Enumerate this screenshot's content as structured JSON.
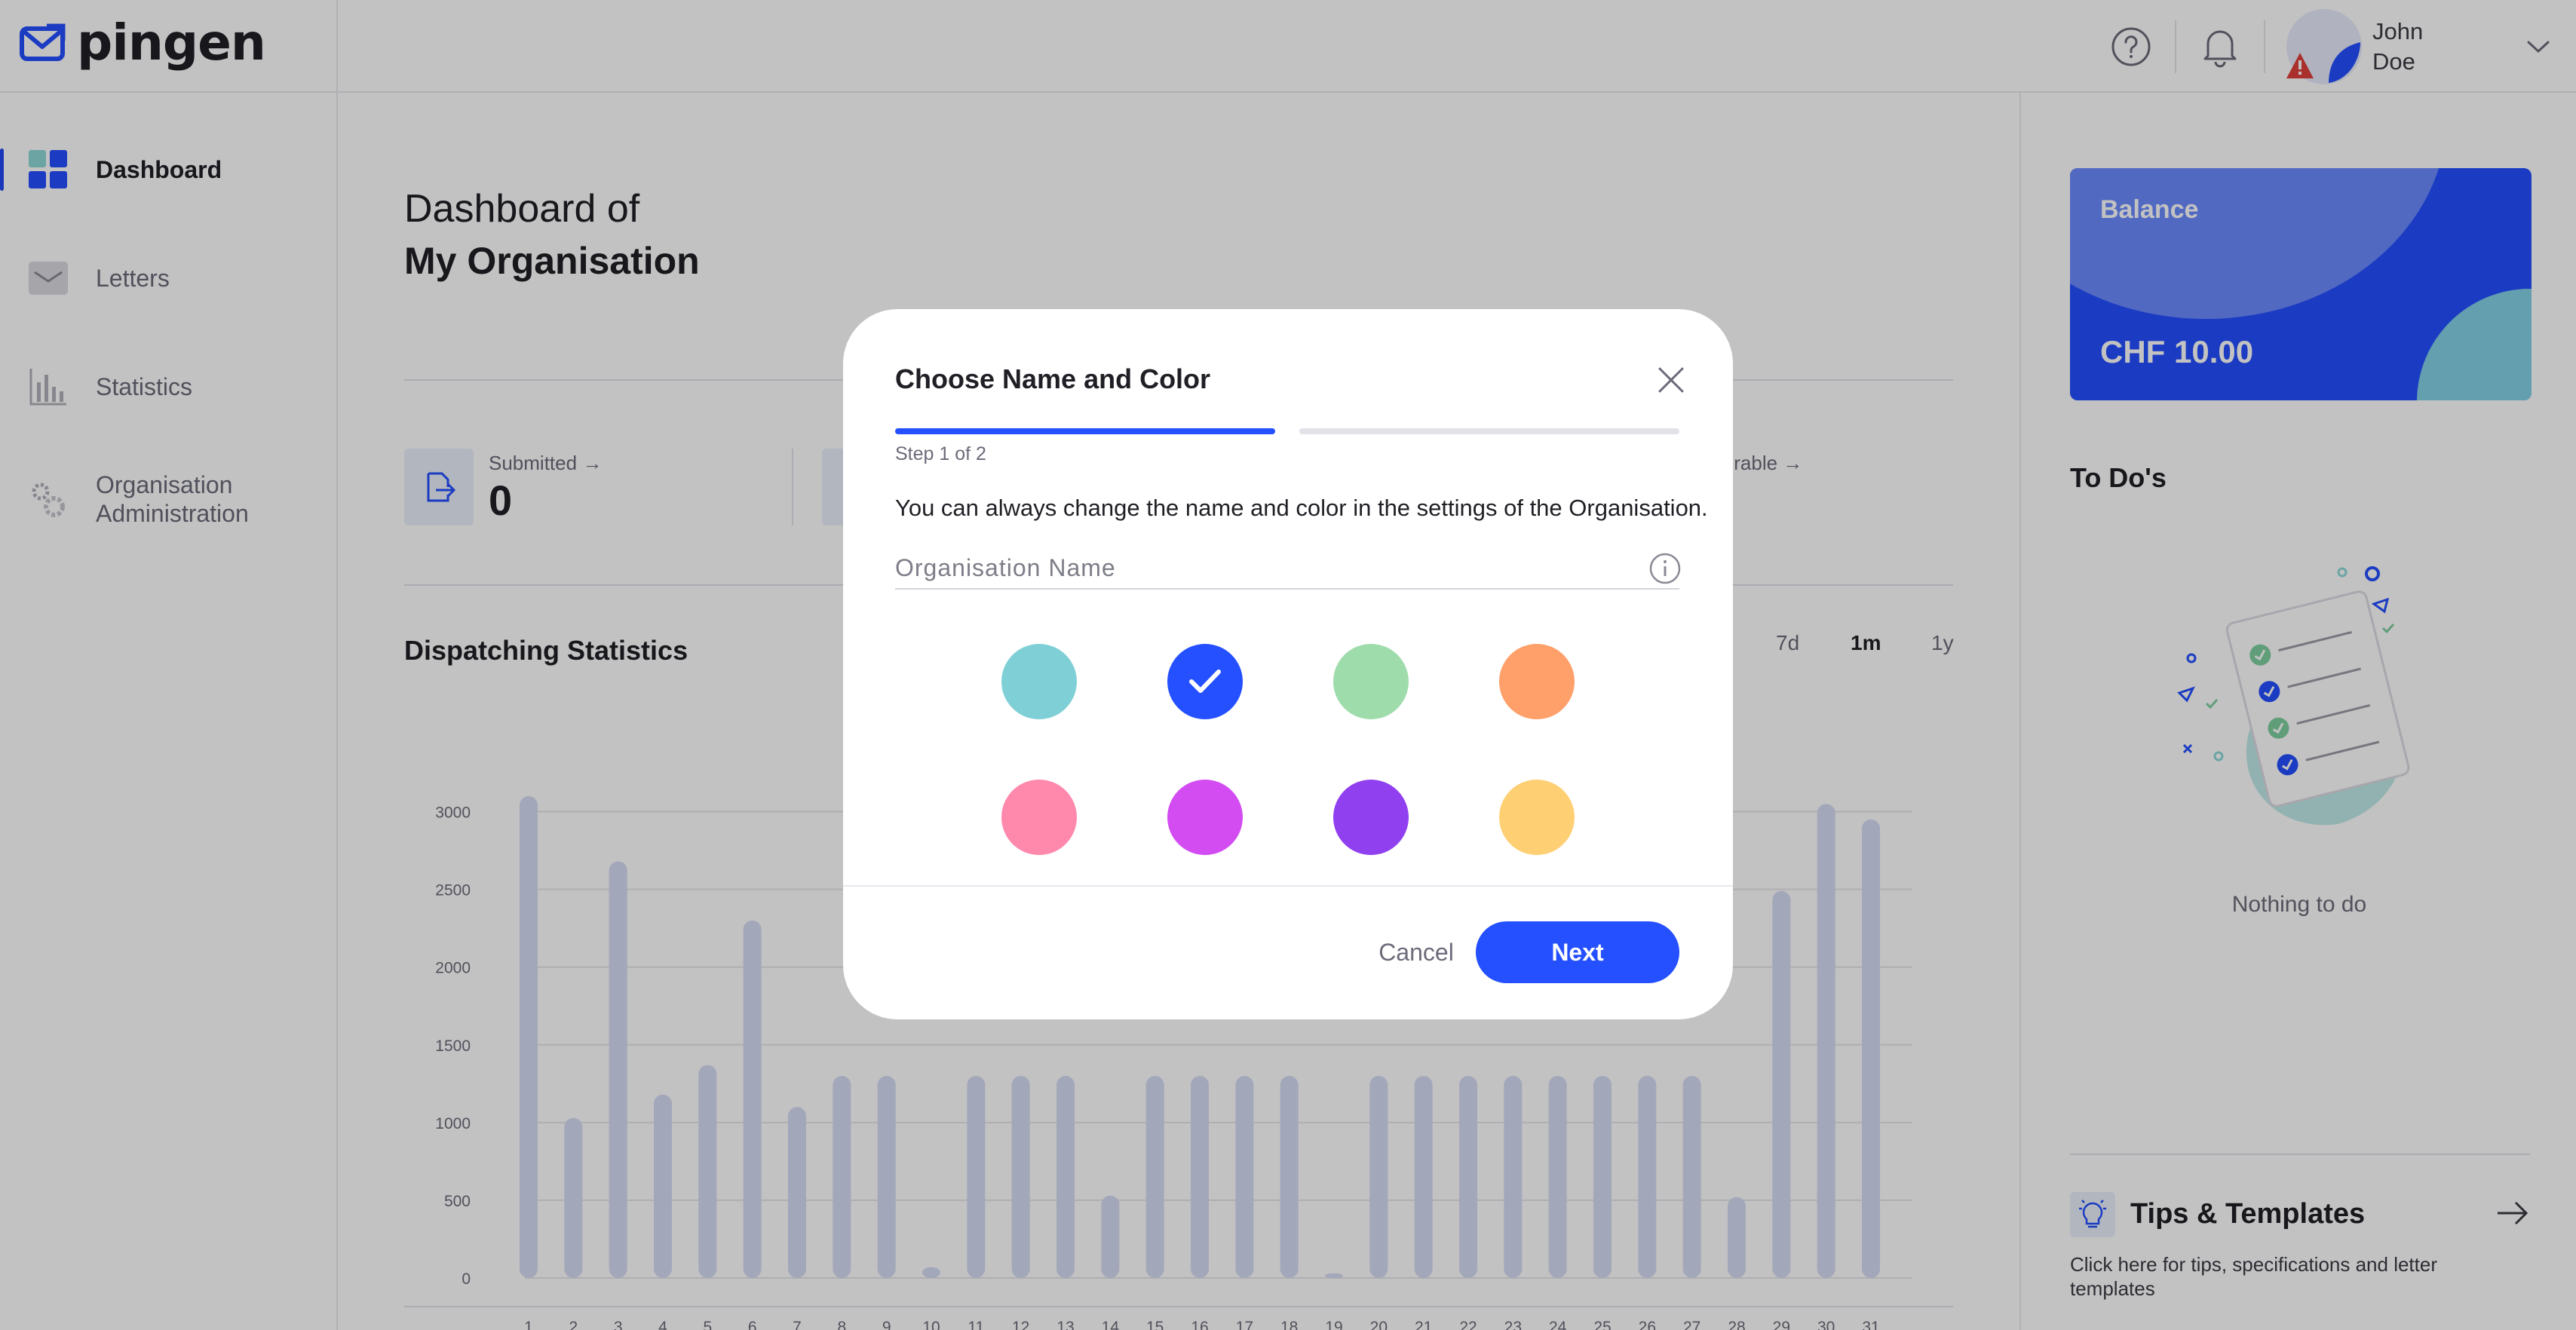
{
  "app": {
    "logo_text": "pingen"
  },
  "header": {
    "help_icon": "help-circle-icon",
    "bell_icon": "bell-icon",
    "user_first": "John",
    "user_last": "Doe"
  },
  "sidebar": {
    "items": [
      {
        "label": "Dashboard",
        "icon": "dashboard-grid-icon",
        "active": true
      },
      {
        "label": "Letters",
        "icon": "envelope-icon",
        "active": false
      },
      {
        "label": "Statistics",
        "icon": "bar-chart-icon",
        "active": false
      },
      {
        "label": "Organisation Administration",
        "icon": "gear-icon",
        "active": false
      }
    ]
  },
  "main": {
    "title_line1": "Dashboard of",
    "title_line2": "My Organisation",
    "stats": [
      {
        "label": "Submitted",
        "value": "0"
      },
      {
        "label": "iverable",
        "value": ""
      }
    ],
    "section_title": "Dispatching Statistics",
    "ranges": [
      "7d",
      "1m",
      "1y"
    ],
    "selected_range": "1m"
  },
  "chart_data": {
    "type": "bar",
    "categories": [
      "1",
      "2",
      "3",
      "4",
      "5",
      "6",
      "7",
      "8",
      "9",
      "10",
      "11",
      "12",
      "13",
      "14",
      "15",
      "16",
      "17",
      "18",
      "19",
      "20",
      "21",
      "22",
      "23",
      "24",
      "25",
      "26",
      "27",
      "28",
      "29",
      "30",
      "31"
    ],
    "values": [
      3100,
      1030,
      2680,
      1180,
      1370,
      2300,
      1100,
      1300,
      1300,
      70,
      1300,
      1300,
      1300,
      530,
      1300,
      1300,
      1300,
      1300,
      30,
      1300,
      1300,
      1300,
      1300,
      1300,
      1300,
      1300,
      1300,
      520,
      2490,
      3050,
      2950
    ],
    "yticks": [
      0,
      500,
      1000,
      1500,
      2000,
      2500,
      3000
    ],
    "ylim": [
      0,
      3250
    ],
    "bar_color": "#d6dcf5",
    "grid": true
  },
  "right": {
    "balance_label": "Balance",
    "balance_amount": "CHF 10.00",
    "todo_title": "To Do's",
    "todo_empty": "Nothing to do",
    "tips_title": "Tips & Templates",
    "tips_text": "Click here for tips, specifications and letter templates"
  },
  "modal": {
    "title": "Choose Name and Color",
    "step_label": "Step 1 of 2",
    "description": "You can always change the name and color in the settings of the Organisation.",
    "name_value": "",
    "name_placeholder": "Organisation Name",
    "colors": [
      {
        "name": "teal",
        "hex": "#7fd0d6",
        "selected": false
      },
      {
        "name": "blue",
        "hex": "#2450ff",
        "selected": true
      },
      {
        "name": "green",
        "hex": "#9fdcac",
        "selected": false
      },
      {
        "name": "orange",
        "hex": "#ff9f6a",
        "selected": false
      },
      {
        "name": "pink",
        "hex": "#ff88ad",
        "selected": false
      },
      {
        "name": "magenta",
        "hex": "#d24cf2",
        "selected": false
      },
      {
        "name": "purple",
        "hex": "#9140f0",
        "selected": false
      },
      {
        "name": "yellow",
        "hex": "#ffcf73",
        "selected": false
      }
    ],
    "cancel_label": "Cancel",
    "next_label": "Next"
  },
  "colors": {
    "accent": "#2450ff",
    "overlay": "rgba(0,0,0,0.24)"
  }
}
